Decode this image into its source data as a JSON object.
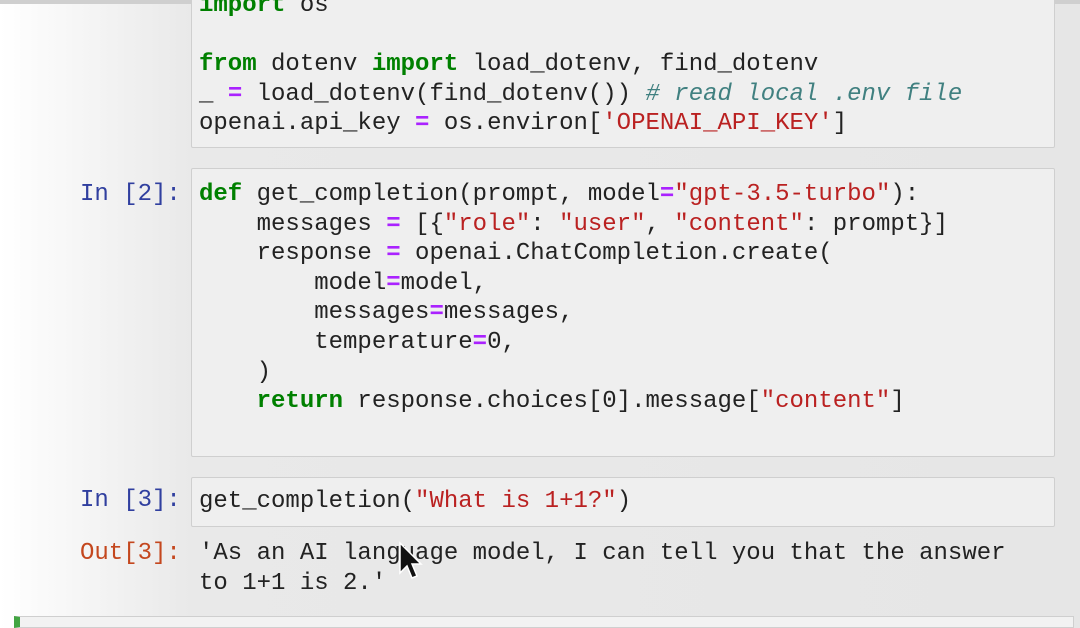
{
  "cells": [
    {
      "prompt": "",
      "lines": [
        [
          {
            "t": "import",
            "c": "kw"
          },
          {
            "t": " os",
            "c": ""
          }
        ],
        [],
        [
          {
            "t": "from",
            "c": "kw"
          },
          {
            "t": " dotenv ",
            "c": ""
          },
          {
            "t": "import",
            "c": "kw"
          },
          {
            "t": " load_dotenv, find_dotenv",
            "c": ""
          }
        ],
        [
          {
            "t": "_ ",
            "c": ""
          },
          {
            "t": "=",
            "c": "op"
          },
          {
            "t": " load_dotenv(find_dotenv()) ",
            "c": ""
          },
          {
            "t": "# read local .env file",
            "c": "cm"
          }
        ],
        [
          {
            "t": "openai.api_key ",
            "c": ""
          },
          {
            "t": "=",
            "c": "op"
          },
          {
            "t": " os.environ[",
            "c": ""
          },
          {
            "t": "'OPENAI_API_KEY'",
            "c": "str"
          },
          {
            "t": "]",
            "c": ""
          }
        ]
      ]
    },
    {
      "prompt": "In [2]:",
      "lines": [
        [
          {
            "t": "def",
            "c": "kw"
          },
          {
            "t": " ",
            "c": ""
          },
          {
            "t": "get_completion",
            "c": "fn"
          },
          {
            "t": "(prompt, model",
            "c": ""
          },
          {
            "t": "=",
            "c": "op"
          },
          {
            "t": "\"gpt-3.5-turbo\"",
            "c": "str"
          },
          {
            "t": "):",
            "c": ""
          }
        ],
        [
          {
            "t": "    messages ",
            "c": ""
          },
          {
            "t": "=",
            "c": "op"
          },
          {
            "t": " [{",
            "c": ""
          },
          {
            "t": "\"role\"",
            "c": "str"
          },
          {
            "t": ": ",
            "c": ""
          },
          {
            "t": "\"user\"",
            "c": "str"
          },
          {
            "t": ", ",
            "c": ""
          },
          {
            "t": "\"content\"",
            "c": "str"
          },
          {
            "t": ": prompt}]",
            "c": ""
          }
        ],
        [
          {
            "t": "    response ",
            "c": ""
          },
          {
            "t": "=",
            "c": "op"
          },
          {
            "t": " openai.ChatCompletion.create(",
            "c": ""
          }
        ],
        [
          {
            "t": "        model",
            "c": ""
          },
          {
            "t": "=",
            "c": "op"
          },
          {
            "t": "model,",
            "c": ""
          }
        ],
        [
          {
            "t": "        messages",
            "c": ""
          },
          {
            "t": "=",
            "c": "op"
          },
          {
            "t": "messages,",
            "c": ""
          }
        ],
        [
          {
            "t": "        temperature",
            "c": ""
          },
          {
            "t": "=",
            "c": "op"
          },
          {
            "t": "0,",
            "c": ""
          }
        ],
        [
          {
            "t": "    )",
            "c": ""
          }
        ],
        [
          {
            "t": "    ",
            "c": ""
          },
          {
            "t": "return",
            "c": "kw"
          },
          {
            "t": " response.choices[0].message[",
            "c": ""
          },
          {
            "t": "\"content\"",
            "c": "str"
          },
          {
            "t": "]",
            "c": ""
          }
        ]
      ]
    },
    {
      "prompt": "In [3]:",
      "lines": [
        [
          {
            "t": "get_completion(",
            "c": ""
          },
          {
            "t": "\"What is 1+1?\"",
            "c": "str"
          },
          {
            "t": ")",
            "c": ""
          }
        ]
      ]
    }
  ],
  "output": {
    "prompt": "Out[3]:",
    "text": "'As an AI language model, I can tell you that the answer\nto 1+1 is 2.'"
  },
  "colors": {
    "keyword": "#008000",
    "string": "#ba2121",
    "operator": "#aa22ff",
    "comment": "#408080",
    "in_prompt": "#303f9f",
    "out_prompt": "#c4471e",
    "selected_cell": "#42a542"
  }
}
